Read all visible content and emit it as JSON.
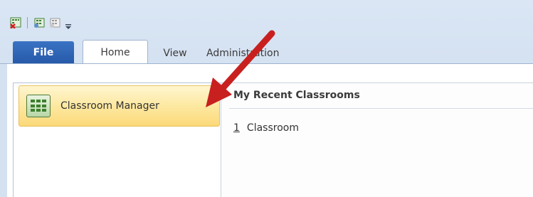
{
  "tabs": {
    "file": "File",
    "home": "Home",
    "view": "View",
    "administration": "Administration"
  },
  "backstage": {
    "nav_item_label": "Classroom Manager"
  },
  "recent": {
    "title": "My Recent Classrooms",
    "items": [
      {
        "number": "1",
        "label": "Classroom"
      }
    ]
  },
  "icons": {
    "qat": [
      "classroom-close-icon",
      "classroom-open-icon",
      "classroom-new-icon",
      "customize-toolbar-dropdown-icon"
    ],
    "nav": "classroom-grid-icon",
    "annotation": "red-arrow"
  },
  "colors": {
    "file_tab": "#2d62b0",
    "selected_item": "#fde79d",
    "arrow": "#c8201f"
  }
}
